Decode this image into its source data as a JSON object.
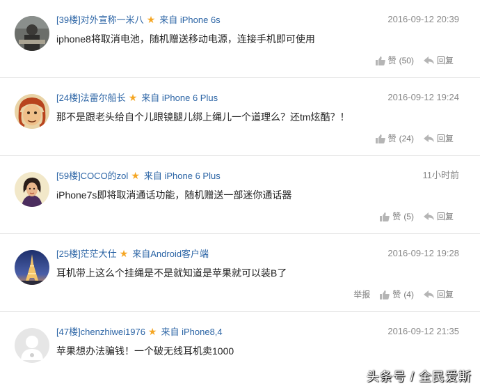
{
  "comments": [
    {
      "floor": "[39楼]对外宣称一米八",
      "device": "来自 iPhone 6s",
      "time": "2016-09-12 20:39",
      "content": "iphone8将取消电池，随机赠送移动电源，连接手机即可使用",
      "like_label": "赞",
      "like_count": "(50)",
      "reply_label": "回复",
      "report_label": "",
      "avatar_icon": "avatar-man-photo"
    },
    {
      "floor": "[24楼]法雷尔船长",
      "device": "来自 iPhone 6 Plus",
      "time": "2016-09-12 19:24",
      "content": "那不是跟老头给自个儿眼镜腿儿绑上绳儿一个道理么？还tm炫酷？！",
      "like_label": "赞",
      "like_count": "(24)",
      "reply_label": "回复",
      "report_label": "",
      "avatar_icon": "avatar-cartoon-face"
    },
    {
      "floor": "[59楼]COCO的zol",
      "device": "来自 iPhone 6 Plus",
      "time": "11小时前",
      "content": "iPhone7s即将取消通话功能，随机赠送一部迷你通话器",
      "like_label": "赞",
      "like_count": "(5)",
      "reply_label": "回复",
      "report_label": "",
      "avatar_icon": "avatar-woman-illustration"
    },
    {
      "floor": "[25楼]茫茫大仕",
      "device": "来自Android客户端",
      "time": "2016-09-12 19:28",
      "content": "耳机带上这么个挂绳是不是就知道是苹果就可以装B了",
      "like_label": "赞",
      "like_count": "(4)",
      "reply_label": "回复",
      "report_label": "举报",
      "avatar_icon": "avatar-eiffel-tower"
    },
    {
      "floor": "[47楼]chenzhiwei1976",
      "device": "来自 iPhone8,4",
      "time": "2016-09-12 21:35",
      "content": "苹果想办法骗钱！一个破无线耳机卖1000",
      "like_label": "",
      "like_count": "",
      "reply_label": "",
      "report_label": "",
      "avatar_icon": "avatar-default"
    }
  ],
  "watermark": "头条号 / 全民爱斯",
  "colors": {
    "username": "#2b64a5",
    "star": "#f5a623",
    "time": "#888888",
    "divider": "#e6e6e6"
  }
}
